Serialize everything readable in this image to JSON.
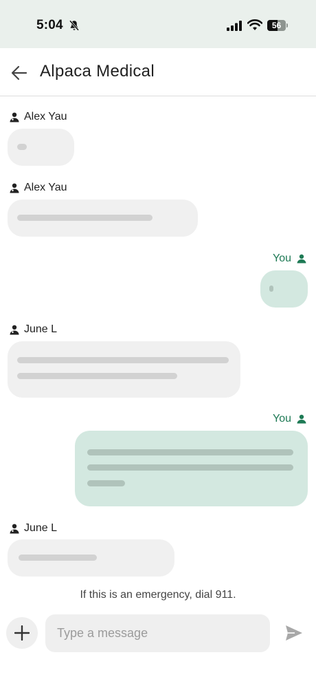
{
  "status_bar": {
    "time": "5:04",
    "battery_level": "56"
  },
  "header": {
    "title": "Alpaca Medical"
  },
  "messages": [
    {
      "sender": "Alex Yau",
      "direction": "incoming",
      "line_fractions": [
        0.2
      ]
    },
    {
      "sender": "Alex Yau",
      "direction": "incoming",
      "line_fractions": [
        0.79
      ]
    },
    {
      "sender": "You",
      "direction": "outgoing",
      "line_fractions": [
        0.15
      ]
    },
    {
      "sender": "June L",
      "direction": "incoming",
      "line_fractions": [
        0.99,
        0.75
      ]
    },
    {
      "sender": "You",
      "direction": "outgoing",
      "line_fractions": [
        0.99,
        0.99,
        0.18
      ]
    },
    {
      "sender": "June L",
      "direction": "incoming",
      "line_fractions": [
        0.54
      ]
    }
  ],
  "footer": {
    "emergency_notice": "If this is an emergency, dial 911."
  },
  "composer": {
    "placeholder": "Type a message"
  },
  "colors": {
    "accent": "#1e7a55",
    "outgoing_bubble": "#d3e8e0",
    "incoming_bubble": "#f0f0f0",
    "status_bar_bg": "#eaf0ec"
  },
  "icons": {
    "back": "arrow-left-icon",
    "add": "plus-icon",
    "send": "send-icon",
    "sender": "doctor-icon",
    "self": "user-icon"
  }
}
